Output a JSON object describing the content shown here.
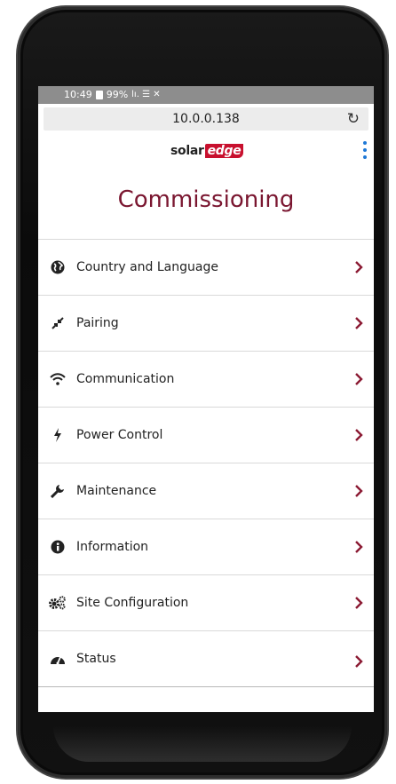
{
  "status_bar": {
    "time": "10:49",
    "battery": "99%",
    "indicators": "lı. ☰ ✕"
  },
  "browser": {
    "url": "10.0.0.138",
    "reload_icon": "reload-icon"
  },
  "brand": {
    "logo_solar": "solar",
    "logo_edge": "edge",
    "accent": "#c8102e"
  },
  "page": {
    "title": "Commissioning",
    "title_color": "#7a1630",
    "chevron_color": "#8b1a33"
  },
  "menu": [
    {
      "label": "Country and Language",
      "icon": "globe-icon"
    },
    {
      "label": "Pairing",
      "icon": "compress-arrows-icon"
    },
    {
      "label": "Communication",
      "icon": "wifi-icon"
    },
    {
      "label": "Power Control",
      "icon": "bolt-icon"
    },
    {
      "label": "Maintenance",
      "icon": "wrench-icon"
    },
    {
      "label": "Information",
      "icon": "info-icon"
    },
    {
      "label": "Site Configuration",
      "icon": "gears-icon"
    },
    {
      "label": "Status",
      "icon": "dashboard-icon"
    }
  ]
}
